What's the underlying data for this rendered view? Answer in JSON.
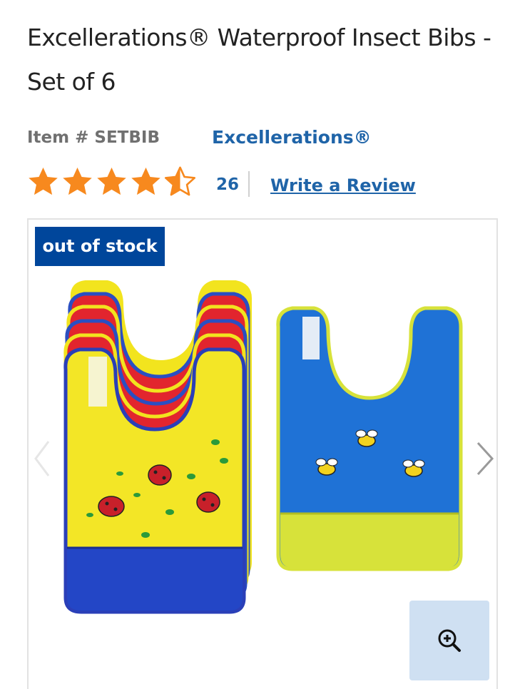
{
  "product": {
    "title": "Excellerations® Waterproof Insect Bibs - Set of 6",
    "item_number": "Item # SETBIB",
    "brand": "Excellerations®",
    "rating": 4.5,
    "review_count": "26",
    "write_review_label": "Write a Review",
    "stock_badge": "out of stock"
  },
  "colors": {
    "brand_blue": "#1f64a8",
    "badge_blue": "#00469b",
    "star_orange": "#f7891e",
    "zoom_bg": "#cfe0f2"
  },
  "icons": {
    "prev": "chevron-left-icon",
    "next": "chevron-right-icon",
    "zoom": "zoom-in-icon",
    "star": "star-icon"
  }
}
